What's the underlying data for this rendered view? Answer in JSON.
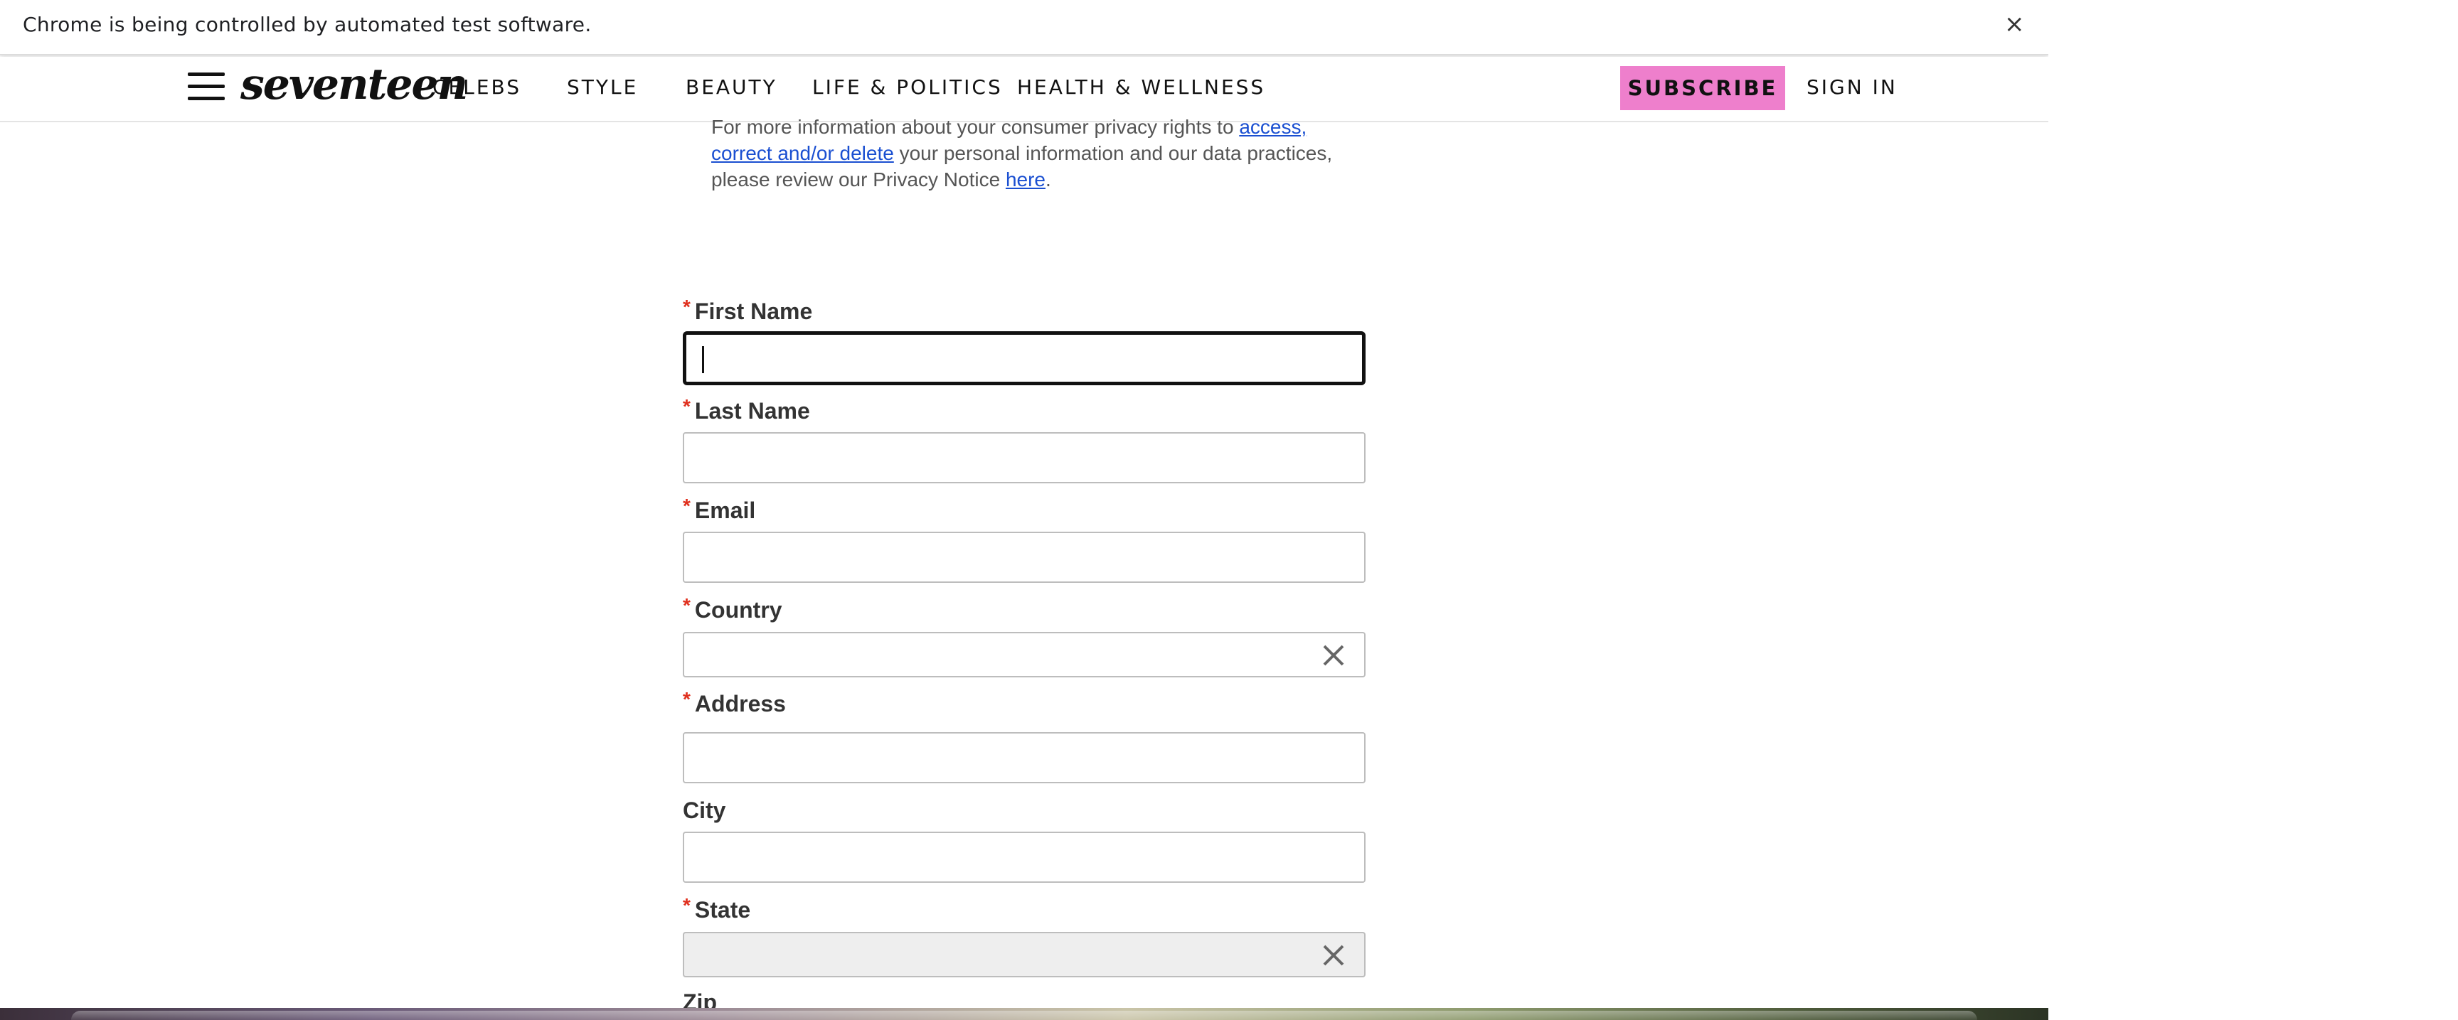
{
  "infobar": {
    "message": "Chrome is being controlled by automated test software.",
    "close_glyph": "×"
  },
  "header": {
    "logo_text": "seventeen",
    "nav": [
      "CELEBS",
      "STYLE",
      "BEAUTY",
      "LIFE & POLITICS",
      "HEALTH & WELLNESS"
    ],
    "subscribe_label": "SUBSCRIBE",
    "signin_label": "SIGN IN",
    "accent_color": "#ee7fcc"
  },
  "privacy": {
    "text_before_link": "For more information about your consumer privacy rights to ",
    "link1": "access, correct and/or delete",
    "text_middle": " your personal information and our data practices, please review our Privacy Notice ",
    "link2": "here",
    "text_end": "."
  },
  "form": {
    "required_marker": "*",
    "first_name_label": "First Name",
    "last_name_label": "Last Name",
    "email_label": "Email",
    "country_label": "Country",
    "address_label": "Address",
    "city_label": "City",
    "state_label": "State",
    "zip_label": "Zip",
    "first_name_value": "",
    "last_name_value": "",
    "email_value": "",
    "address_value": "",
    "city_value": ""
  }
}
